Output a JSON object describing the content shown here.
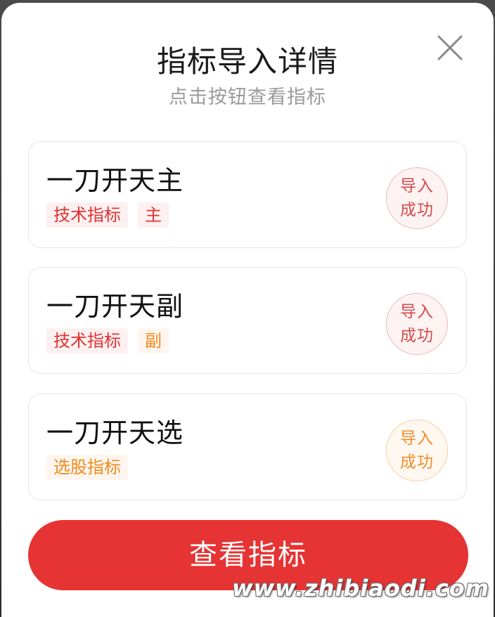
{
  "dialog": {
    "title": "指标导入详情",
    "subtitle": "点击按钮查看指标",
    "close_icon": "close-icon"
  },
  "items": [
    {
      "name": "一刀开天主",
      "tags": [
        "技术指标",
        "主"
      ],
      "status_line1": "导入",
      "status_line2": "成功",
      "status_color": "#d84a4a"
    },
    {
      "name": "一刀开天副",
      "tags": [
        "技术指标",
        "副"
      ],
      "status_line1": "导入",
      "status_line2": "成功",
      "status_color": "#d84a4a"
    },
    {
      "name": "一刀开天选",
      "tags": [
        "选股指标"
      ],
      "status_line1": "导入",
      "status_line2": "成功",
      "status_color": "#ef8e2a"
    }
  ],
  "primary_button": {
    "label": "查看指标",
    "color": "#e63333"
  },
  "watermark": "www.zhibiaodi.com"
}
